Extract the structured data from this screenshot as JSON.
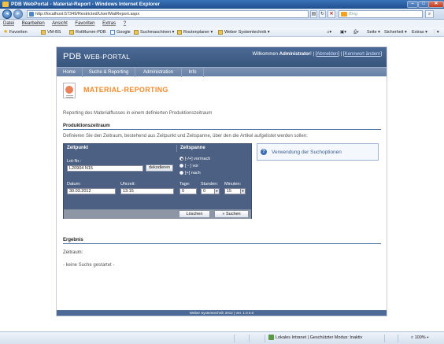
{
  "window": {
    "title": "PDB WebPortal - Material-Report - Windows Internet Explorer"
  },
  "browser": {
    "address": "http://localhost:57349/Restricted/User/MatReport.aspx",
    "search_placeholder": "Bing",
    "menu": [
      "Datei",
      "Bearbeiten",
      "Ansicht",
      "Favoriten",
      "Extras",
      "?"
    ],
    "favorites_label": "Favoriten",
    "favorites": [
      "VM-BS",
      "RotMumm-PDB",
      "Google",
      "Suchmaschinen",
      "Routenplaner",
      "Weber Systemtechnik"
    ],
    "tools": [
      "Seite",
      "Sicherheit",
      "Extras"
    ]
  },
  "portal": {
    "logo": "PDB",
    "logo_suffix": "Web-Portal",
    "welcome_prefix": "Willkommen",
    "user": "Administrator",
    "logout": "Abmelden",
    "change_password": "Kennwort ändern",
    "nav": [
      "Home",
      "Suche & Reporting",
      "Administration",
      "Info"
    ],
    "footer": "Weber Systemtechnik 2012 | Ver. 1.0.0.0"
  },
  "page": {
    "title": "Material-Reporting",
    "description": "Reporting des Materialflusses in einem definierten Produktionszeitraum",
    "section_period": "Produktionszeitraum",
    "period_description": "Definieren Sie den Zeitraum, bestehend aus Zeitpunkt und Zeitspanne, über den die Artikel aufgelistet werden sollen:",
    "section_result": "Ergebnis",
    "result_label": "Zeitraum:",
    "no_search": "- keine Suche gestartet -"
  },
  "form": {
    "zeitpunkt_header": "Zeitpunkt",
    "zeitspanne_header": "Zeitspanne",
    "lot_label": "Lot-Nr.:",
    "lot_value": "L20904 N15",
    "decode_button": "dekodieren",
    "date_label": "Datum:",
    "date_value": "30.03.2012",
    "time_label": "Uhrzeit:",
    "time_value": "13:15",
    "radio_options": [
      "[-/+] vor/nach",
      "[ - ] vor",
      "[+] nach"
    ],
    "radio_selected": 0,
    "days_label": "Tage:",
    "days_value": "0",
    "hours_label": "Stunden:",
    "hours_value": "0",
    "minutes_label": "Minuten:",
    "minutes_value": "15",
    "clear_button": "Löschen",
    "search_button": "» Suchen"
  },
  "help": {
    "label": "Verwendung der Suchoptionen"
  },
  "status": {
    "zone": "Lokales Intranet | Geschützter Modus: Inaktiv",
    "zoom": "100%"
  }
}
